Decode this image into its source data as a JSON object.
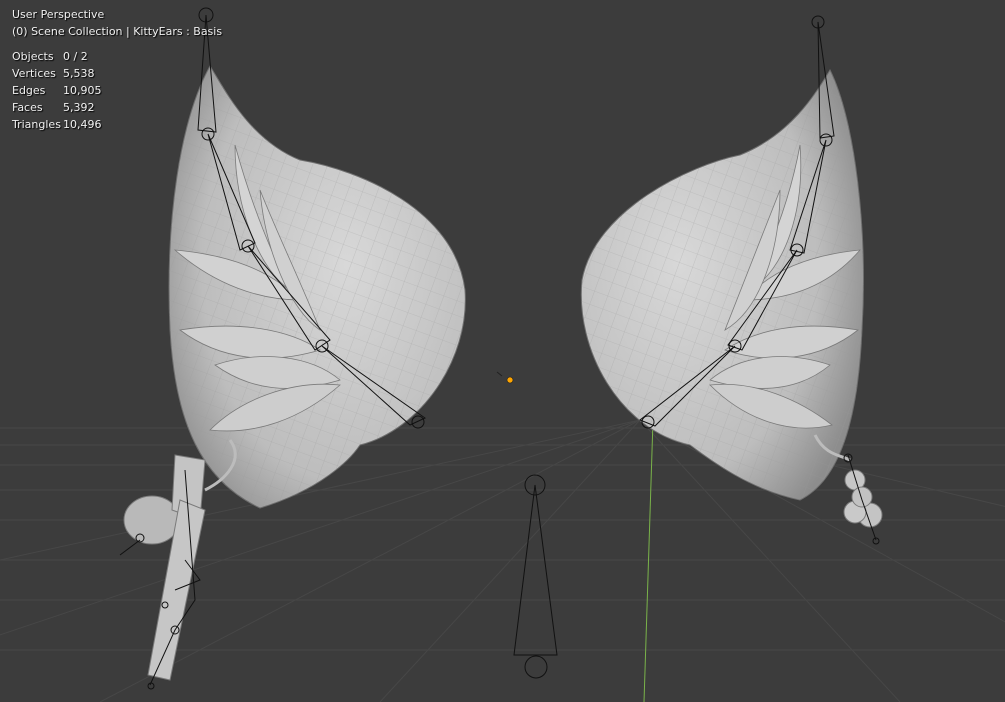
{
  "viewport": {
    "perspective_label": "User Perspective",
    "collection_label": "(0) Scene Collection | KittyEars : Basis"
  },
  "stats": [
    {
      "label": "Objects",
      "value": "0 / 2"
    },
    {
      "label": "Vertices",
      "value": "5,538"
    },
    {
      "label": "Edges",
      "value": "10,905"
    },
    {
      "label": "Faces",
      "value": "5,392"
    },
    {
      "label": "Triangles",
      "value": "10,496"
    }
  ],
  "colors": {
    "background": "#3c3c3c",
    "grid": "#4a4a4a",
    "mesh": "#c9c9c9",
    "mesh_shadow": "#8a8a8a",
    "wire": "#9a9a9a",
    "bone": "#111111",
    "y_axis": "#7ab34a",
    "origin": "#ffa500"
  }
}
